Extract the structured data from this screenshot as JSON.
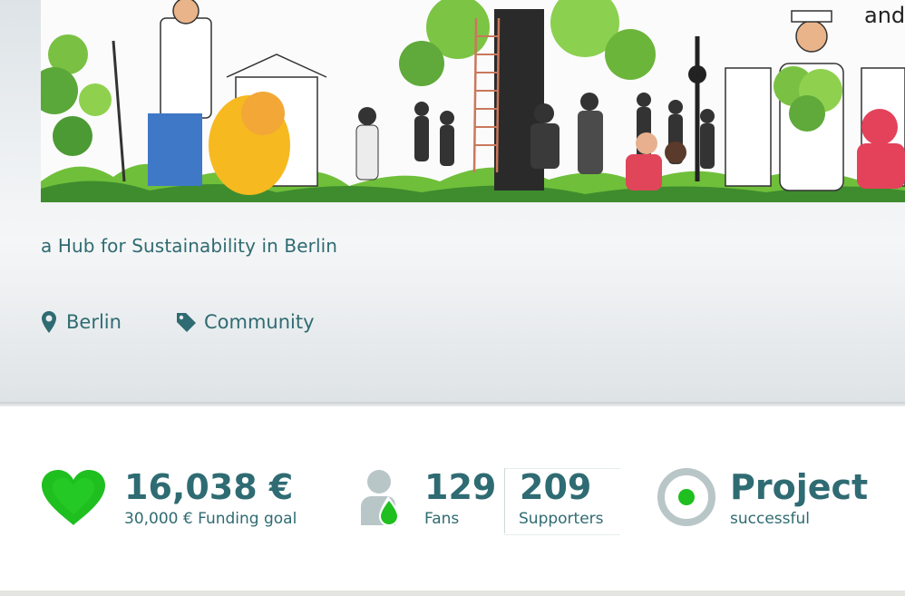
{
  "project": {
    "tagline": "a Hub for Sustainability in Berlin",
    "location": "Berlin",
    "category": "Community",
    "hero_text": "and"
  },
  "stats": {
    "funding": {
      "amount": "16,038 €",
      "goal_label": "30,000 € Funding goal"
    },
    "fans": {
      "count": "129",
      "label": "Fans"
    },
    "supporters": {
      "count": "209",
      "label": "Supporters"
    },
    "status": {
      "title": "Project",
      "label": "successful"
    }
  },
  "icons": {
    "location": "map-pin-icon",
    "category": "tag-icon",
    "funding": "heart-icon",
    "fans": "person-drop-icon",
    "status": "target-icon"
  },
  "colors": {
    "text": "#2f6b72",
    "accent_green": "#1fbf1f",
    "icon_grey": "#b9c6c8"
  }
}
